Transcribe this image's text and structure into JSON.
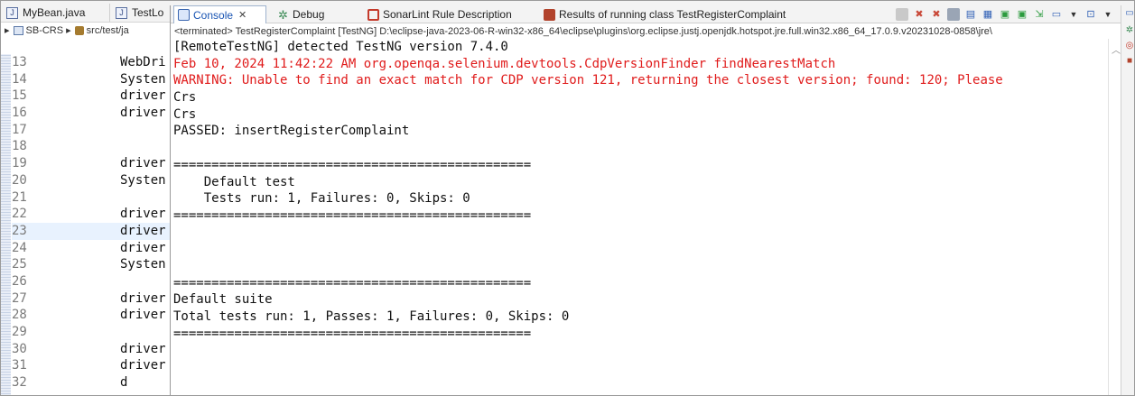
{
  "editor": {
    "tabs": [
      {
        "label": "MyBean.java"
      },
      {
        "label": "TestLo"
      }
    ],
    "breadcrumb": {
      "project": "SB-CRS",
      "folder": "src/test/ja"
    },
    "lines": [
      {
        "num": "13",
        "code": "WebDri"
      },
      {
        "num": "14",
        "code": "Systen"
      },
      {
        "num": "15",
        "code": "driver"
      },
      {
        "num": "16",
        "code": "driver"
      },
      {
        "num": "17",
        "code": ""
      },
      {
        "num": "18",
        "code": ""
      },
      {
        "num": "19",
        "code": "driver"
      },
      {
        "num": "20",
        "code": "Systen"
      },
      {
        "num": "21",
        "code": ""
      },
      {
        "num": "22",
        "code": "driver"
      },
      {
        "num": "23",
        "code": "driver"
      },
      {
        "num": "24",
        "code": "driver"
      },
      {
        "num": "25",
        "code": "Systen"
      },
      {
        "num": "26",
        "code": ""
      },
      {
        "num": "27",
        "code": "driver"
      },
      {
        "num": "28",
        "code": "driver"
      },
      {
        "num": "29",
        "code": ""
      },
      {
        "num": "30",
        "code": "driver"
      },
      {
        "num": "31",
        "code": "driver"
      },
      {
        "num": "32",
        "code": "d"
      }
    ]
  },
  "console": {
    "tabs": {
      "console": "Console",
      "debug": "Debug",
      "sonar": "SonarLint Rule Description",
      "results": "Results of running class TestRegisterComplaint"
    },
    "status": "<terminated> TestRegisterComplaint [TestNG] D:\\eclipse-java-2023-06-R-win32-x86_64\\eclipse\\plugins\\org.eclipse.justj.openjdk.hotspot.jre.full.win32.x86_64_17.0.9.v20231028-0858\\jre\\",
    "lines": [
      {
        "text": "[RemoteTestNG] detected TestNG version 7.4.0",
        "kind": "out"
      },
      {
        "text": "Feb 10, 2024 11:42:22 AM org.openqa.selenium.devtools.CdpVersionFinder findNearestMatch",
        "kind": "err"
      },
      {
        "text": "WARNING: Unable to find an exact match for CDP version 121, returning the closest version; found: 120; Please",
        "kind": "err"
      },
      {
        "text": "Crs",
        "kind": "out"
      },
      {
        "text": "Crs",
        "kind": "out"
      },
      {
        "text": "PASSED: insertRegisterComplaint",
        "kind": "out"
      },
      {
        "text": "",
        "kind": "out"
      },
      {
        "text": "===============================================",
        "kind": "out"
      },
      {
        "text": "    Default test",
        "kind": "out"
      },
      {
        "text": "    Tests run: 1, Failures: 0, Skips: 0",
        "kind": "out"
      },
      {
        "text": "===============================================",
        "kind": "out"
      },
      {
        "text": "",
        "kind": "out"
      },
      {
        "text": "",
        "kind": "out"
      },
      {
        "text": "",
        "kind": "out"
      },
      {
        "text": "===============================================",
        "kind": "out"
      },
      {
        "text": "Default suite",
        "kind": "out"
      },
      {
        "text": "Total tests run: 1, Passes: 1, Failures: 0, Skips: 0",
        "kind": "out"
      },
      {
        "text": "===============================================",
        "kind": "out"
      },
      {
        "text": "",
        "kind": "out"
      },
      {
        "text": "",
        "kind": "out"
      }
    ]
  },
  "colors": {
    "error_text": "#e01b1b",
    "accent": "#1a55b3",
    "current_line": "#e8f2fe"
  },
  "icons": [
    "java-file-icon",
    "console-icon",
    "debug-icon",
    "sonarlint-icon",
    "testng-results-icon",
    "close-icon"
  ]
}
